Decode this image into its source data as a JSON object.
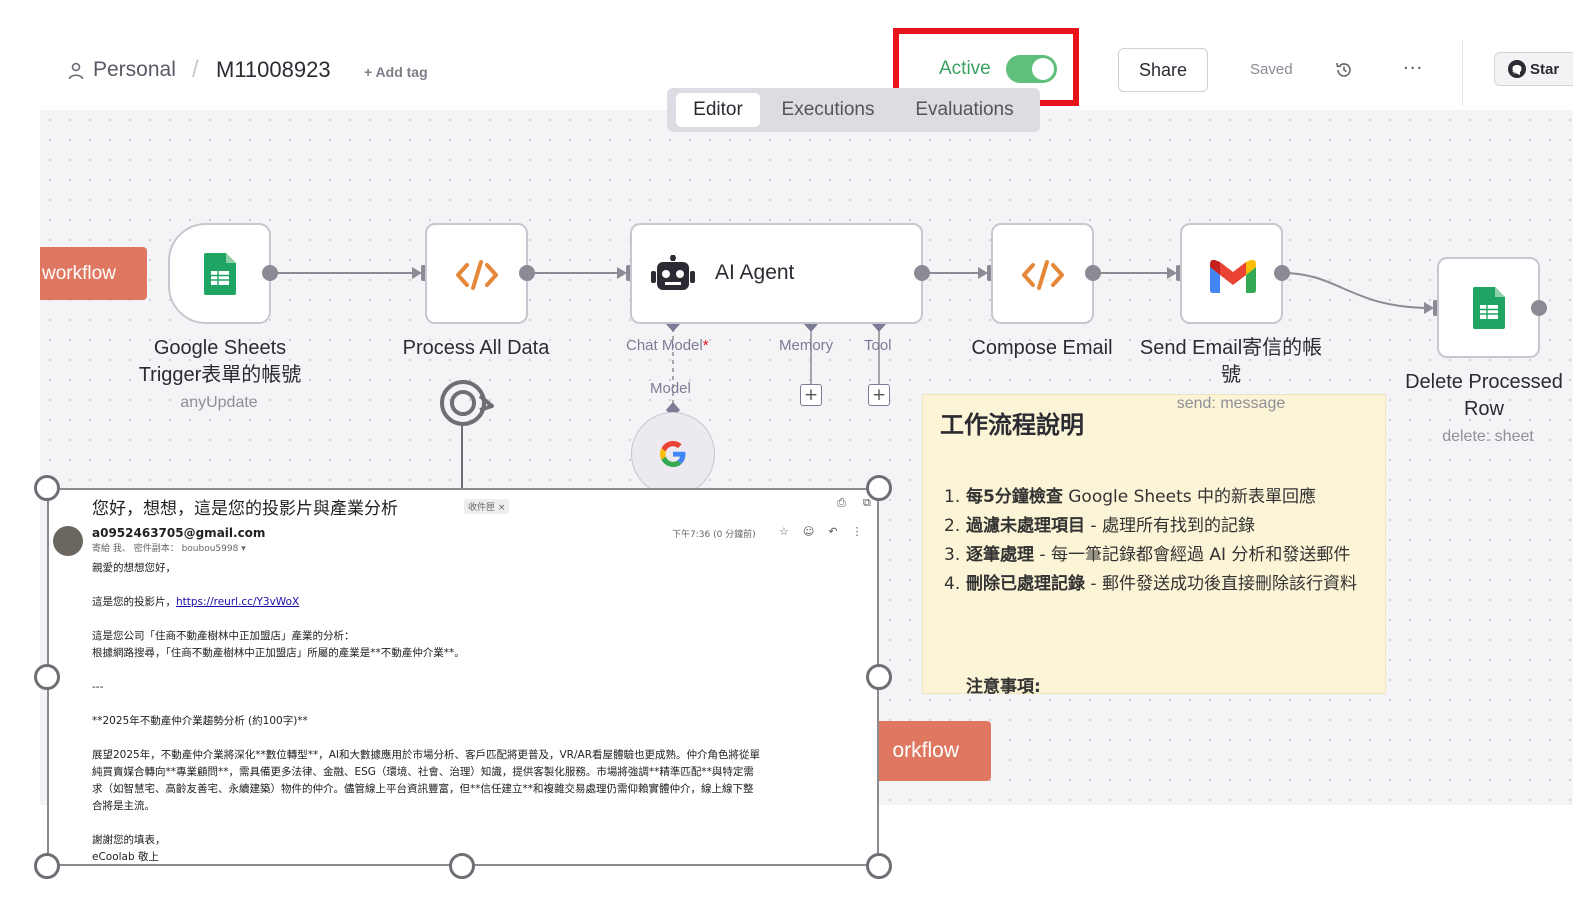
{
  "header": {
    "breadcrumb": {
      "project": "Personal",
      "separator": "/",
      "workflow": "M11008923"
    },
    "add_tag": "+ Add tag",
    "active_label": "Active",
    "active_state": true,
    "share": "Share",
    "saved": "Saved",
    "more": "···",
    "star": "Star"
  },
  "tabs": [
    {
      "label": "Editor",
      "selected": true
    },
    {
      "label": "Executions",
      "selected": false
    },
    {
      "label": "Evaluations",
      "selected": false
    }
  ],
  "canvas": {
    "left_pill": "workflow",
    "right_pill": "orkflow",
    "nodes": {
      "google_sheets_trigger": {
        "label_line1": "Google Sheets",
        "label_line2": "Trigger表單的帳號",
        "sub": "anyUpdate"
      },
      "process_all_data": {
        "label": "Process All Data"
      },
      "ai_agent": {
        "label": "AI Agent",
        "chat_model": "Chat Model",
        "required_mark": "*",
        "memory": "Memory",
        "tool": "Tool",
        "model": "Model"
      },
      "compose_email": {
        "label": "Compose Email"
      },
      "send_email": {
        "label_line1": "Send Email寄信的帳",
        "label_line2": "號",
        "sub": "send: message"
      },
      "delete_row": {
        "label_line1": "Delete Processed",
        "label_line2": "Row",
        "sub": "delete: sheet"
      }
    },
    "sticky": {
      "title": "工作流程說明",
      "items": [
        {
          "num": "1.",
          "bold": "每5分鐘檢查",
          "text": " Google Sheets 中的新表單回應"
        },
        {
          "num": "2.",
          "bold": "過濾未處理項目",
          "text": " - 處理所有找到的記錄"
        },
        {
          "num": "3.",
          "bold": "逐筆處理",
          "text": " - 每一筆記錄都會經過 AI 分析和發送郵件"
        },
        {
          "num": "4.",
          "bold": "刪除已處理記錄",
          "text": " - 郵件發送成功後直接刪除該行資料"
        }
      ],
      "note_heading": "注意事項:"
    }
  },
  "email": {
    "subject": "您好，想想，這是您的投影片與產業分析",
    "badge": "收件匣 ×",
    "sender": "a0952463705@gmail.com",
    "to_line": "寄給 我、 密件副本： boubou5998 ▾",
    "time": "下午7:36 (0 分鐘前)",
    "greeting": "親愛的想想您好，",
    "slides_prefix": "這是您的投影片，",
    "slides_link": "https://reurl.cc/Y3vWoX",
    "analysis_line1": "這是您公司「住商不動產樹林中正加盟店」產業的分析：",
    "analysis_line2": "根據網路搜尋，「住商不動產樹林中正加盟店」所屬的產業是**不動產仲介業**。",
    "divider": "---",
    "trend_heading": "**2025年不動產仲介業趨勢分析 (約100字)**",
    "trend_line1": "展望2025年，不動產仲介業將深化**數位轉型**，AI和大數據應用於市場分析、客戶匹配將更普及，VR/AR看屋體驗也更成熟。仲介角色將從單",
    "trend_line2": "純買賣媒合轉向**專業顧問**，需具備更多法律、金融、ESG（環境、社會、治理）知識，提供客製化服務。市場將強調**精準匹配**與特定需",
    "trend_line3": "求（如智慧宅、高齡友善宅、永續建築）物件的仲介。儘管線上平台資訊豐富，但**信任建立**和複雜交易處理仍需仰賴實體仲介，線上線下整",
    "trend_line4": "合將是主流。",
    "thanks": "謝謝您的填表，",
    "signature": "eCoolab 敬上"
  },
  "colors": {
    "active_green": "#3da163",
    "toggle_green": "#5fbf7c",
    "highlight_red": "#e8141c",
    "pill_salmon": "#e07861",
    "sticky_yellow": "#fbf4d6",
    "code_orange": "#e5883a",
    "sheets_green": "#1fa463"
  },
  "icons": [
    "user-icon",
    "history-icon",
    "more-icon",
    "github-icon",
    "google-sheets-icon",
    "code-icon",
    "robot-icon",
    "gmail-icon",
    "google-icon",
    "rotate-handle-icon",
    "plus-icon"
  ]
}
